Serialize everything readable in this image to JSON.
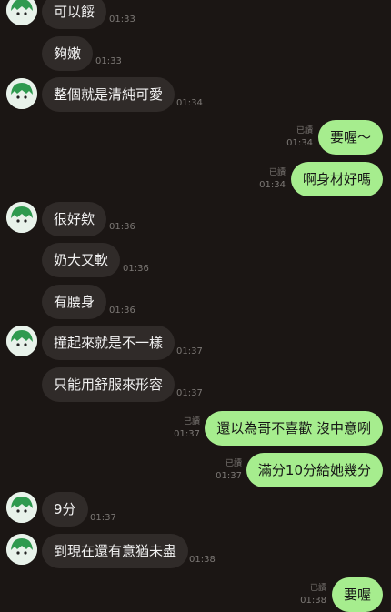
{
  "colors": {
    "background": "#1b1614",
    "incoming_bubble": "#302b29",
    "outgoing_bubble": "#a6ed8e",
    "avatar_bg": "#e8f2ea",
    "avatar_hair": "#2f9a4f",
    "text_light": "#f2f2f2",
    "timestamp": "#7c7875"
  },
  "avatar_icon": "green-hair-avatar-icon",
  "messages": [
    {
      "dir": "in",
      "text": "可以餒",
      "time": "01:33"
    },
    {
      "dir": "in",
      "text": "夠嫩",
      "time": "01:33"
    },
    {
      "dir": "in",
      "text": "整個就是清純可愛",
      "time": "01:34"
    },
    {
      "dir": "out",
      "text": "要喔～",
      "time": "01:34",
      "read": "已讀"
    },
    {
      "dir": "out",
      "text": "啊身材好嗎",
      "time": "01:34",
      "read": "已讀"
    },
    {
      "dir": "in",
      "text": "很好欸",
      "time": "01:36"
    },
    {
      "dir": "in",
      "text": "奶大又軟",
      "time": "01:36"
    },
    {
      "dir": "in",
      "text": "有腰身",
      "time": "01:36"
    },
    {
      "dir": "in",
      "text": "撞起來就是不一樣",
      "time": "01:37"
    },
    {
      "dir": "in",
      "text": "只能用舒服來形容",
      "time": "01:37"
    },
    {
      "dir": "out",
      "text": "還以為哥不喜歡 沒中意咧",
      "time": "01:37",
      "read": "已讀"
    },
    {
      "dir": "out",
      "text": "滿分10分給她幾分",
      "time": "01:37",
      "read": "已讀"
    },
    {
      "dir": "in",
      "text": "9分",
      "time": "01:37"
    },
    {
      "dir": "in",
      "text": "到現在還有意猶未盡",
      "time": "01:38"
    },
    {
      "dir": "out",
      "text": "要喔",
      "time": "01:38",
      "read": "已讀"
    }
  ]
}
